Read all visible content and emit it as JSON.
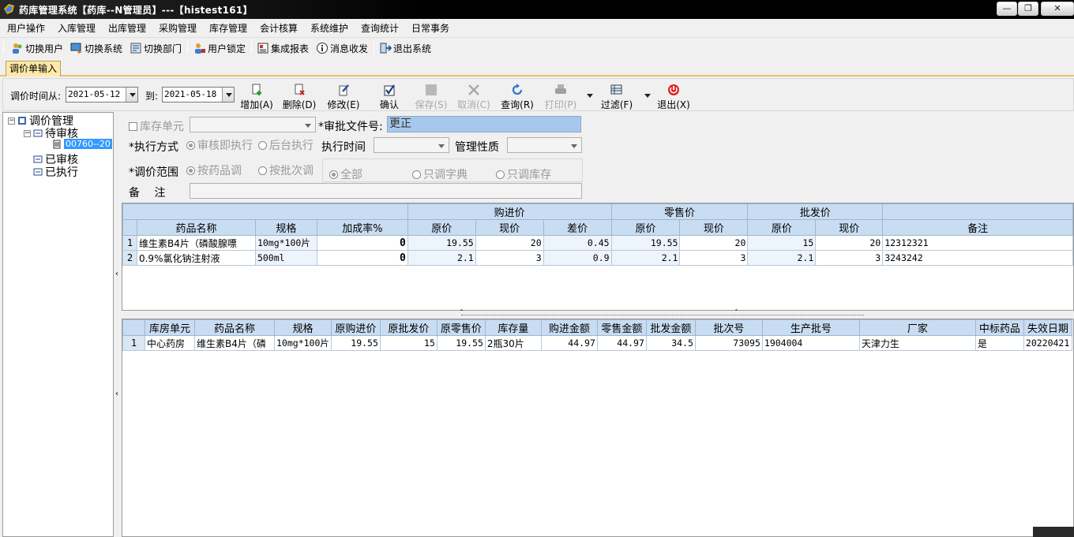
{
  "window": {
    "title": "药库管理系统【药库--N管理员】---【histest161】",
    "controls": [
      "—",
      "❐",
      "✕"
    ]
  },
  "menu": [
    "用户操作",
    "入库管理",
    "出库管理",
    "采购管理",
    "库存管理",
    "会计核算",
    "系统维护",
    "查询统计",
    "日常事务"
  ],
  "toolbar": {
    "switch_user": "切换用户",
    "switch_system": "切换系统",
    "switch_dept": "切换部门",
    "lock_user": "用户锁定",
    "reports": "集成报表",
    "messages": "消息收发",
    "exit_system": "退出系统"
  },
  "tab": {
    "label": "调价单输入"
  },
  "filter": {
    "from_label": "调价时间从:",
    "from_date": "2021-05-12",
    "to_label": "到:",
    "to_date": "2021-05-18",
    "buttons": {
      "add": "增加(A)",
      "delete": "删除(D)",
      "modify": "修改(E)",
      "confirm": "确认",
      "save": "保存(S)",
      "cancel": "取消(C)",
      "query": "查询(R)",
      "print": "打印(P)",
      "filter": "过滤(F)",
      "exit": "退出(X)"
    }
  },
  "tree": {
    "root": "调价管理",
    "pending": "待审核",
    "pending_item": "00760--20",
    "approved": "已审核",
    "executed": "已执行"
  },
  "form": {
    "store_unit_label": "库存单元",
    "approval_doc_label": "*审批文件号:",
    "approval_doc_value": "更正",
    "exec_mode_label": "*执行方式",
    "exec_opt1": "审核即执行",
    "exec_opt2": "后台执行",
    "exec_time_label": "执行时间",
    "mgmt_label": "管理性质",
    "scope_label": "*调价范围",
    "scope_opt1": "按药品调",
    "scope_opt2": "按批次调",
    "range_all": "全部",
    "range_dict": "只调字典",
    "range_stock": "只调库存",
    "remark_label": "备　 注"
  },
  "upper_grid": {
    "group_headers": {
      "purchase": "购进价",
      "retail": "零售价",
      "wholesale": "批发价"
    },
    "headers": {
      "name": "药品名称",
      "spec": "规格",
      "markup": "加成率%",
      "p_orig": "原价",
      "p_cur": "现价",
      "p_diff": "差价",
      "r_orig": "原价",
      "r_cur": "现价",
      "w_orig": "原价",
      "w_cur": "现价",
      "remark": "备注"
    },
    "rows": [
      {
        "n": "1",
        "name": "维生素B4片（磷酸腺嘌",
        "spec": "10mg*100片",
        "markup": "0",
        "p_orig": "19.55",
        "p_cur": "20",
        "p_diff": "0.45",
        "r_orig": "19.55",
        "r_cur": "20",
        "w_orig": "15",
        "w_cur": "20",
        "remark": "12312321"
      },
      {
        "n": "2",
        "name": "0.9%氯化钠注射液",
        "spec": "500ml",
        "markup": "0",
        "p_orig": "2.1",
        "p_cur": "3",
        "p_diff": "0.9",
        "r_orig": "2.1",
        "r_cur": "3",
        "w_orig": "2.1",
        "w_cur": "3",
        "remark": "3243242"
      }
    ]
  },
  "lower_grid": {
    "headers": {
      "store": "库房单元",
      "name": "药品名称",
      "spec": "规格",
      "p_orig": "原购进价",
      "w_orig": "原批发价",
      "r_orig": "原零售价",
      "qty": "库存量",
      "p_amt": "购进金额",
      "r_amt": "零售金额",
      "w_amt": "批发金额",
      "batch": "批次号",
      "lot": "生产批号",
      "maker": "厂家",
      "bid": "中标药品",
      "expiry": "失效日期"
    },
    "rows": [
      {
        "n": "1",
        "store": "中心药房",
        "name": "维生素B4片（磷",
        "spec": "10mg*100片",
        "p_orig": "19.55",
        "w_orig": "15",
        "r_orig": "19.55",
        "qty": "2瓶30片",
        "p_amt": "44.97",
        "r_amt": "44.97",
        "w_amt": "34.5",
        "batch": "73095",
        "lot": "1904004",
        "maker": "天津力生",
        "bid": "是",
        "expiry": "20220421"
      }
    ]
  },
  "colors": {
    "header_blue": "#c9ddf2",
    "tab_gold": "#ffe9a8",
    "selection": "#3399ff"
  }
}
